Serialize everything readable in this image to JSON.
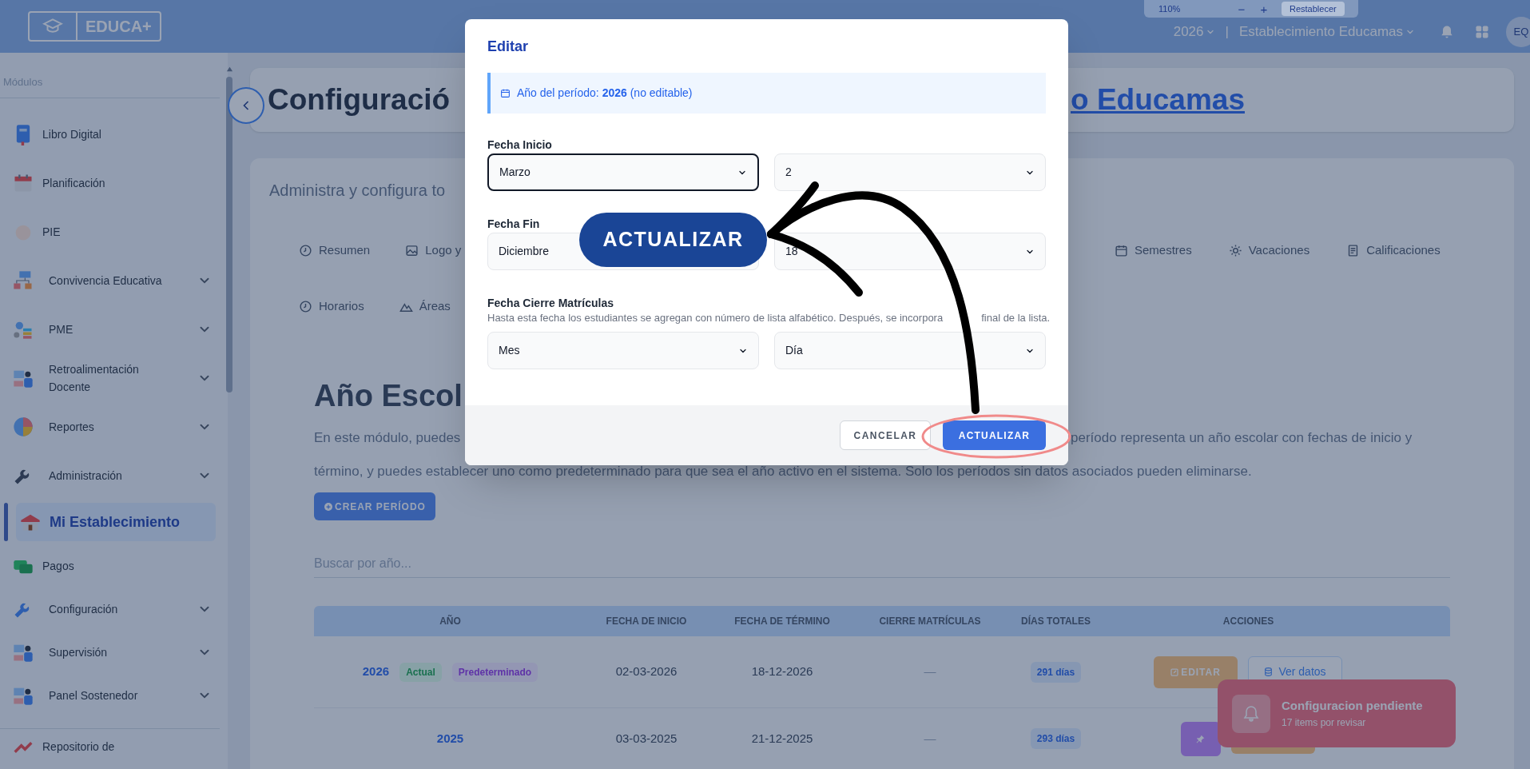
{
  "topbar": {
    "logo_text": "EDUCA+",
    "year_selector": "2026",
    "separator": "|",
    "establishment_selector": "Establecimiento Educamas",
    "avatar_initials": "EQ"
  },
  "zoom_popup": {
    "zoom_value": "110%",
    "zoom_out": "−",
    "zoom_in": "+",
    "reset_button": "Restablecer"
  },
  "sidebar": {
    "section_label": "Módulos",
    "items": [
      {
        "label": "Libro Digital",
        "has_submenu": false,
        "selected": false
      },
      {
        "label": "Planificación",
        "has_submenu": false,
        "selected": false
      },
      {
        "label": "PIE",
        "has_submenu": false,
        "selected": false
      },
      {
        "label": "Convivencia Educativa",
        "has_submenu": true,
        "selected": false
      },
      {
        "label": "PME",
        "has_submenu": true,
        "selected": false
      },
      {
        "label": "Retroalimentación Docente",
        "has_submenu": true,
        "selected": false
      },
      {
        "label": "Reportes",
        "has_submenu": true,
        "selected": false
      },
      {
        "label": "Administración",
        "has_submenu": true,
        "selected": false
      },
      {
        "label": "Mi Establecimiento",
        "has_submenu": false,
        "selected": true
      },
      {
        "label": "Pagos",
        "has_submenu": false,
        "selected": false
      },
      {
        "label": "Configuración",
        "has_submenu": true,
        "selected": false
      },
      {
        "label": "Supervisión",
        "has_submenu": true,
        "selected": false
      },
      {
        "label": "Panel Sostenedor",
        "has_submenu": true,
        "selected": false
      }
    ],
    "footer_item": "Repositorio de"
  },
  "header": {
    "title_left": "Configuració",
    "title_right": "o Educamas"
  },
  "config_card": {
    "description": "Administra y configura to",
    "tab_rows": [
      {
        "left": [
          "Resumen",
          "Logo y"
        ],
        "right": [
          "Semestres",
          "Vacaciones",
          "Calificaciones"
        ]
      },
      {
        "left": [
          "Horarios",
          "Áreas"
        ]
      }
    ]
  },
  "school_year": {
    "title": "Año Escol",
    "intro_line_1_left": "En este módulo, puedes",
    "intro_line_1_right": "período representa un año escolar con fechas de inicio y",
    "intro_line_2": "término, y puedes establecer uno como predeterminado para que sea el año activo en el sistema. Solo los períodos sin datos asociados pueden eliminarse.",
    "create_button": "CREAR PERÍODO",
    "search_placeholder": "Buscar por año...",
    "table": {
      "columns": [
        "AÑO",
        "FECHA DE INICIO",
        "FECHA DE TÉRMINO",
        "CIERRE MATRÍCULAS",
        "DÍAS TOTALES",
        "ACCIONES"
      ],
      "rows": [
        {
          "year": "2026",
          "badges": [
            {
              "label": "Actual",
              "kind": "current"
            },
            {
              "label": "Predeterminado",
              "kind": "default"
            }
          ],
          "start": "02-03-2026",
          "end": "18-12-2026",
          "enrollment_close": "—",
          "total_days": "291 días",
          "actions": [
            {
              "kind": "edit",
              "label": "EDITAR"
            },
            {
              "kind": "view",
              "label": "Ver datos"
            }
          ]
        },
        {
          "year": "2025",
          "start": "03-03-2025",
          "end": "21-12-2025",
          "enrollment_close": "—",
          "total_days": "293 días",
          "actions": [
            {
              "kind": "pin"
            },
            {
              "kind": "edit"
            }
          ]
        }
      ]
    }
  },
  "toast": {
    "title": "Configuracion pendiente",
    "subtitle": "17 items por revisar"
  },
  "edit_dialog": {
    "title": "Editar",
    "info": "Año del período: **2026** (no editable)",
    "fields": [
      {
        "label": "Fecha Inicio",
        "month": "Marzo",
        "day": "2",
        "focused": true
      },
      {
        "label": "Fecha Fin",
        "month": "Diciembre",
        "day": "18",
        "focused": false
      },
      {
        "label": "Fecha Cierre Matrículas",
        "hint_before": "Hasta esta fecha los estudiantes se agregan con número de lista alfabético. Después, se incorpora",
        "hint_after": "final de la lista.",
        "month": "Mes",
        "day": "Día",
        "focused": false
      }
    ],
    "buttons": [
      {
        "kind": "cancel",
        "label": "CANCELAR"
      },
      {
        "kind": "primary",
        "label": "ACTUALIZAR"
      }
    ]
  },
  "annotation": {
    "callout": "ACTUALIZAR"
  }
}
